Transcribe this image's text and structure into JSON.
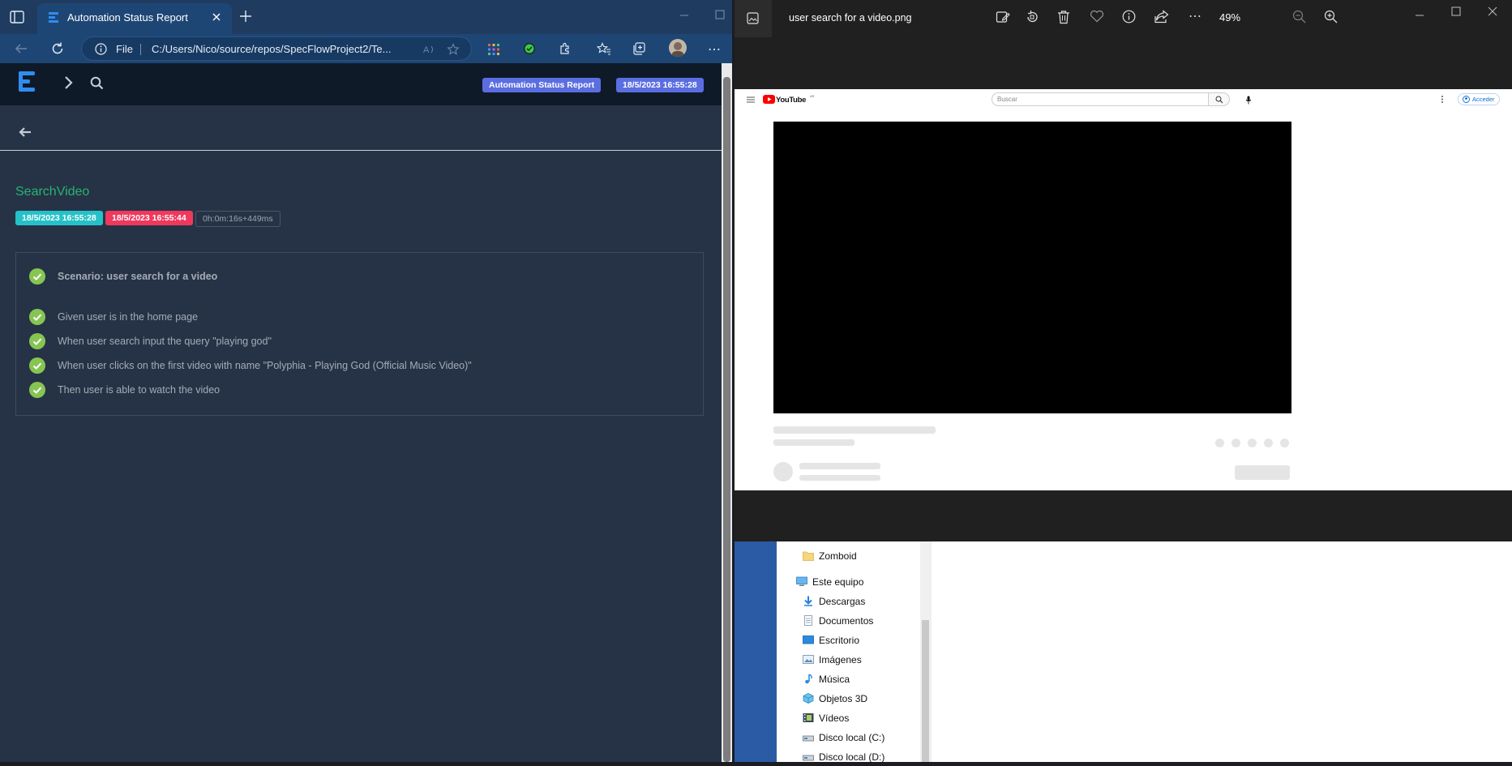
{
  "browser": {
    "tab_title": "Automation Status Report",
    "address_prefix": "File",
    "url": "C:/Users/Nico/source/repos/SpecFlowProject2/Te..."
  },
  "report": {
    "header_badge_title": "Automation Status Report",
    "header_badge_time": "18/5/2023 16:55:28",
    "test_name": "SearchVideo",
    "start_time": "18/5/2023 16:55:28",
    "end_time": "18/5/2023 16:55:44",
    "duration": "0h:0m:16s+449ms",
    "status_colors": {
      "pass": "#87c553",
      "start": "#25c1c8",
      "end": "#f0385d",
      "test_name": "#27b46e"
    },
    "scenario": "Scenario: user search for a video",
    "steps": [
      "Given user is in the home page",
      "When user search input the query \"playing god\"",
      "When user clicks on the first video with name \"Polyphia - Playing God (Official Music Video)\"",
      "Then user is able to watch the video"
    ]
  },
  "photos": {
    "file_title": "user search for a video.png",
    "zoom": "49%",
    "image": {
      "logo_text": "YouTube",
      "logo_sup": "AR",
      "search_placeholder": "Buscar",
      "login_label": "Acceder"
    }
  },
  "explorer": {
    "items": [
      {
        "label": "Zomboid",
        "icon": "folder-icon"
      },
      {
        "label": "Este equipo",
        "icon": "computer-icon"
      },
      {
        "label": "Descargas",
        "icon": "downloads-icon"
      },
      {
        "label": "Documentos",
        "icon": "documents-icon"
      },
      {
        "label": "Escritorio",
        "icon": "desktop-icon"
      },
      {
        "label": "Imágenes",
        "icon": "pictures-icon"
      },
      {
        "label": "Música",
        "icon": "music-icon"
      },
      {
        "label": "Objetos 3D",
        "icon": "3d-objects-icon"
      },
      {
        "label": "Vídeos",
        "icon": "videos-icon"
      },
      {
        "label": "Disco local (C:)",
        "icon": "drive-icon"
      },
      {
        "label": "Disco local (D:)",
        "icon": "drive-icon"
      }
    ]
  }
}
